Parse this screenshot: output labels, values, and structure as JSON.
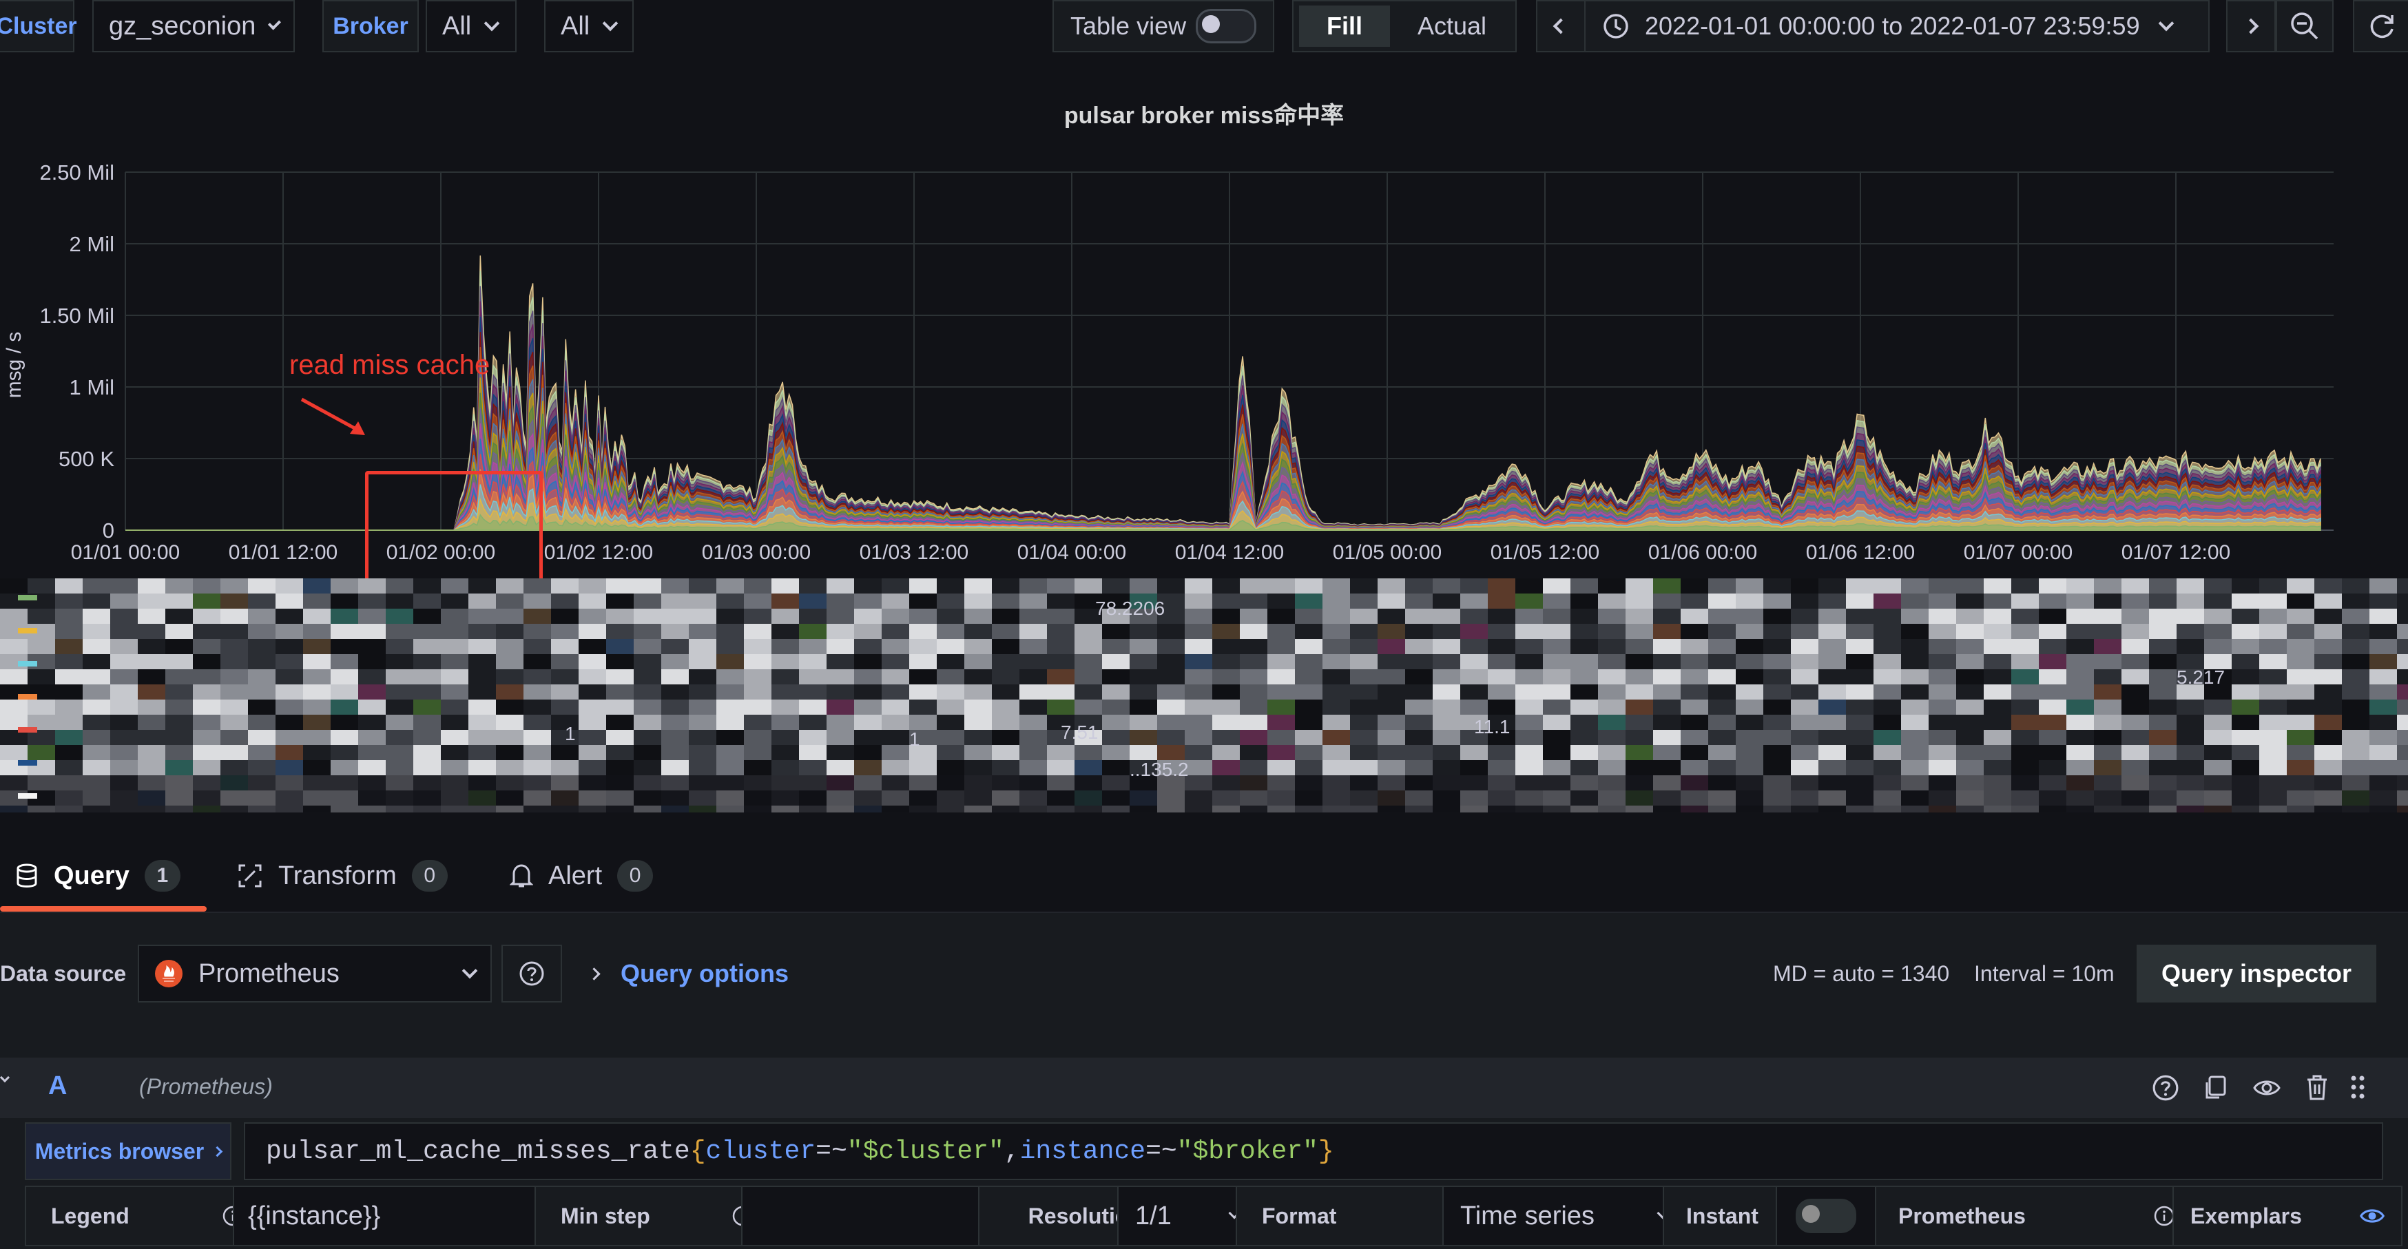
{
  "toolbar": {
    "cluster_label": "Cluster",
    "cluster_value": "gz_seconion",
    "broker_label": "Broker",
    "broker_value": "All",
    "third_value": "All",
    "table_view_label": "Table view",
    "fill_label": "Fill",
    "actual_label": "Actual",
    "time_range": "2022-01-01 00:00:00 to 2022-01-07 23:59:59"
  },
  "panel": {
    "title": "pulsar broker miss命中率",
    "annotation": "read miss cache",
    "annotation_color": "#f03a2f"
  },
  "chart_data": {
    "type": "area",
    "title": "pulsar broker miss命中率",
    "ylabel": "msg / s",
    "ylim": [
      0,
      2500000
    ],
    "yticks": [
      "0",
      "500 K",
      "1 Mil",
      "1.50 Mil",
      "2 Mil",
      "2.50 Mil"
    ],
    "xticks": [
      "01/01 00:00",
      "01/01 12:00",
      "01/02 00:00",
      "01/02 12:00",
      "01/03 00:00",
      "01/03 12:00",
      "01/04 00:00",
      "01/04 12:00",
      "01/05 00:00",
      "01/05 12:00",
      "01/06 00:00",
      "01/06 12:00",
      "01/07 00:00",
      "01/07 12:00"
    ],
    "x_hours": [
      0,
      25,
      26,
      27,
      28,
      29,
      30,
      31,
      32,
      33,
      34,
      36,
      38,
      40,
      42,
      44,
      46,
      48,
      50,
      52,
      54,
      60,
      66,
      72,
      78,
      84,
      85,
      86,
      88,
      90,
      91,
      92,
      94,
      100,
      106,
      108,
      110,
      112,
      114,
      116,
      118,
      120,
      122,
      124,
      126,
      128,
      130,
      132,
      134,
      136,
      138,
      140,
      142,
      144,
      150,
      156,
      162,
      167
    ],
    "total_stacked": [
      0,
      0,
      450000,
      1900000,
      1300000,
      1700000,
      1400000,
      1600000,
      1500000,
      1100000,
      1350000,
      900000,
      700000,
      400000,
      500000,
      350000,
      350000,
      250000,
      1100000,
      350000,
      250000,
      200000,
      150000,
      100000,
      80000,
      50000,
      1500000,
      50000,
      1000000,
      200000,
      50000,
      50000,
      40000,
      50000,
      500000,
      150000,
      300000,
      350000,
      200000,
      550000,
      400000,
      550000,
      350000,
      500000,
      200000,
      550000,
      450000,
      800000,
      450000,
      300000,
      550000,
      450000,
      800000,
      400000,
      450000,
      500000,
      520000,
      500000
    ],
    "series_colors": [
      "#7eb26d",
      "#eab839",
      "#6ed0e0",
      "#ef843c",
      "#e24d42",
      "#1f78c1",
      "#ba43a9",
      "#705da0",
      "#508642",
      "#cca300",
      "#447ebc",
      "#c15c17",
      "#890f02",
      "#0a437c",
      "#6d1f62",
      "#584477",
      "#b7dbab",
      "#f4d598"
    ],
    "grid": true,
    "legend_placement": "bottom"
  },
  "legend_values": [
    "78.2206",
    "7.51",
    "1",
    "1",
    "11.1",
    "..135.2",
    "5.217"
  ],
  "tabs": [
    {
      "label": "Query",
      "count": "1"
    },
    {
      "label": "Transform",
      "count": "0"
    },
    {
      "label": "Alert",
      "count": "0"
    }
  ],
  "datasource": {
    "label": "Data source",
    "value": "Prometheus",
    "query_options": "Query options",
    "md": "MD = auto = 1340",
    "interval": "Interval = 10m",
    "inspector": "Query inspector"
  },
  "query": {
    "ref": "A",
    "ds_hint": "(Prometheus)",
    "metrics_browser": "Metrics browser",
    "expr_metric": "pulsar_ml_cache_misses_rate",
    "expr_open": "{",
    "expr_k1": "cluster",
    "expr_op1": "=~",
    "expr_v1": "\"$cluster\"",
    "expr_sep": ",",
    "expr_k2": "instance",
    "expr_op2": "=~",
    "expr_v2": "\"$broker\"",
    "expr_close": "}",
    "legend_label": "Legend",
    "legend_value": "{{instance}}",
    "minstep_label": "Min step",
    "minstep_value": "",
    "resolution_label": "Resolution",
    "resolution_value": "1/1",
    "format_label": "Format",
    "format_value": "Time series",
    "instant_label": "Instant",
    "prom_label": "Prometheus",
    "exemplars_label": "Exemplars"
  }
}
